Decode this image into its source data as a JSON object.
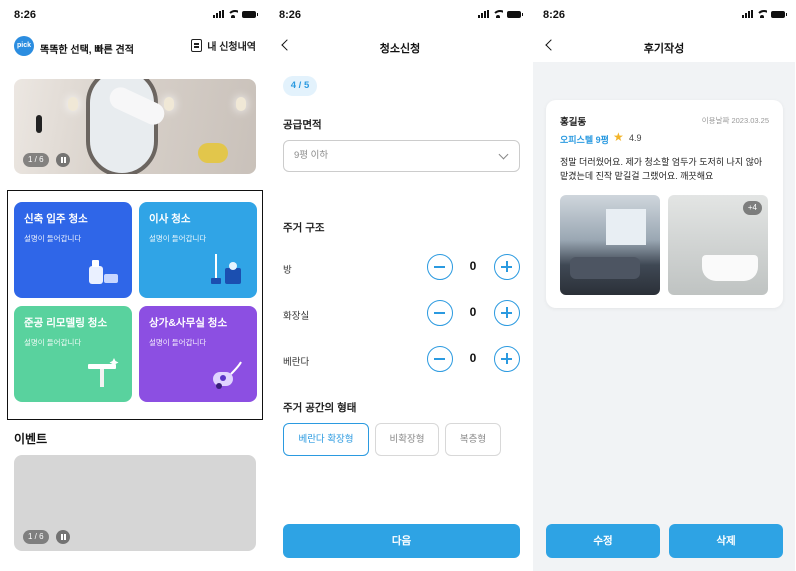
{
  "status": {
    "time": "8:26"
  },
  "screen1": {
    "brand": "똑똑한 선택, 빠른 견적",
    "logo_text": "pick",
    "requests_link": "내 신청내역",
    "banner": {
      "counter": "1 / 6"
    },
    "services": [
      {
        "title": "신축 입주 청소",
        "desc": "설명이 들어갑니다",
        "color": "#2f66e8"
      },
      {
        "title": "이사 청소",
        "desc": "설명이 들어갑니다",
        "color": "#30a4e6"
      },
      {
        "title": "준공 리모델링 청소",
        "desc": "설명이 들어갑니다",
        "color": "#59d29e"
      },
      {
        "title": "상가&사무실 청소",
        "desc": "설명이 들어갑니다",
        "color": "#8c4fe2"
      }
    ],
    "events_title": "이벤트",
    "events": {
      "counter": "1 / 6"
    }
  },
  "screen2": {
    "title": "청소신청",
    "step": "4 / 5",
    "area_label": "공급면적",
    "area_value": "9평 이하",
    "structure_label": "주거 구조",
    "rooms": [
      {
        "label": "방",
        "value": "0"
      },
      {
        "label": "화장실",
        "value": "0"
      },
      {
        "label": "베란다",
        "value": "0"
      }
    ],
    "type_label": "주거 공간의 형태",
    "types": [
      "베란다 확장형",
      "비확장형",
      "복층형"
    ],
    "selected_type": "베란다 확장형",
    "next": "다음"
  },
  "screen3": {
    "title": "후기작성",
    "review": {
      "name": "홍길동",
      "date": "이용날짜 2023.03.25",
      "tag": "오피스텔 9평",
      "rating": "4.9",
      "text": "정말 더러웠어요. 제가 청소할 엄두가 도저히 나지 않아 맡겼는데 진작 맡길걸 그랬어요. 깨끗해요",
      "more_photos": "+4"
    },
    "edit": "수정",
    "delete": "삭제"
  },
  "colors": {
    "accent": "#2ea3e4",
    "accent_text": "#2b9ae0",
    "star": "#f3b429"
  },
  "icons": [
    "signal-icon",
    "wifi-icon",
    "battery-icon",
    "document-icon",
    "back-icon",
    "chevron-down-icon",
    "minus-icon",
    "plus-icon",
    "pause-icon",
    "star-icon"
  ]
}
